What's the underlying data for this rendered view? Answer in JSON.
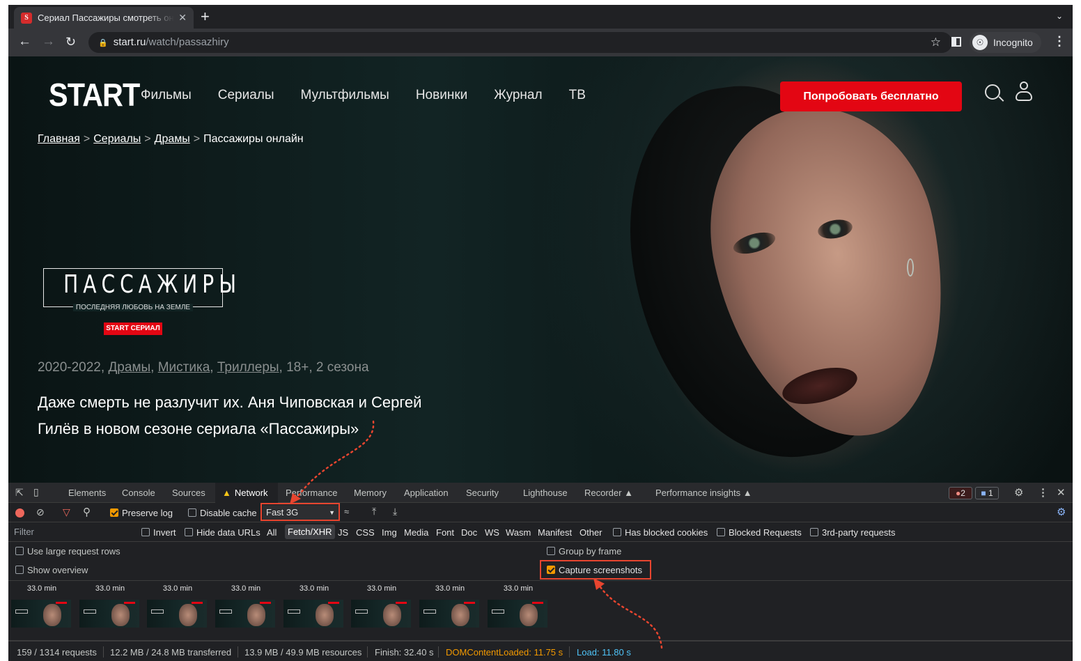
{
  "browser": {
    "tab_title": "Сериал Пассажиры смотреть онлайн",
    "tab_close": "✕",
    "new_tab": "+",
    "tab_menu": "⌄",
    "url_host": "start.ru",
    "url_path": "/watch/passazhiry",
    "incognito_label": "Incognito"
  },
  "site": {
    "logo": "START",
    "nav": [
      "Фильмы",
      "Сериалы",
      "Мультфильмы",
      "Новинки",
      "Журнал",
      "ТВ"
    ],
    "cta": "Попробовать бесплатно",
    "breadcrumb": [
      "Главная",
      "Сериалы",
      "Драмы",
      "Пассажиры онлайн"
    ],
    "breadcrumb_sep": ">",
    "title_logo": "ПАССАЖИРЫ",
    "title_logo_sub": "ПОСЛЕДНЯЯ ЛЮБОВЬ НА ЗЕМЛЕ",
    "badge": "START СЕРИАЛ",
    "meta": {
      "years": "2020-2022",
      "genres": [
        "Драмы",
        "Мистика",
        "Триллеры"
      ],
      "age": "18+",
      "seasons": "2 сезона"
    },
    "description": "Даже смерть не разлучит их. Аня Чиповская и Сергей Гилёв в новом сезоне сериала «Пассажиры»"
  },
  "devtools": {
    "tabs": [
      "Elements",
      "Console",
      "Sources",
      "Network",
      "Performance",
      "Memory",
      "Application",
      "Security",
      "Lighthouse",
      "Recorder",
      "Performance insights"
    ],
    "active_tab": "Network",
    "errors": "2",
    "messages": "1",
    "preserve_log": "Preserve log",
    "disable_cache": "Disable cache",
    "throttling": "Fast 3G",
    "filter_placeholder": "Filter",
    "invert": "Invert",
    "hide_data_urls": "Hide data URLs",
    "filter_types": [
      "All",
      "Fetch/XHR",
      "JS",
      "CSS",
      "Img",
      "Media",
      "Font",
      "Doc",
      "WS",
      "Wasm",
      "Manifest",
      "Other"
    ],
    "active_filter": "Fetch/XHR",
    "has_blocked_cookies": "Has blocked cookies",
    "blocked_requests": "Blocked Requests",
    "third_party": "3rd-party requests",
    "use_large_rows": "Use large request rows",
    "show_overview": "Show overview",
    "group_by_frame": "Group by frame",
    "capture_screenshots": "Capture screenshots",
    "screenshot_times": [
      "33.0 min",
      "33.0 min",
      "33.0 min",
      "33.0 min",
      "33.0 min",
      "33.0 min",
      "33.0 min",
      "33.0 min"
    ],
    "status": {
      "requests": "159 / 1314 requests",
      "transferred": "12.2 MB / 24.8 MB transferred",
      "resources": "13.9 MB / 49.9 MB resources",
      "finish": "Finish: 32.40 s",
      "dom_content_loaded": "DOMContentLoaded: 11.75 s",
      "load": "Load: 11.80 s"
    }
  },
  "colors": {
    "brand_red": "#e30613",
    "annotation": "#e8452f",
    "checkbox_on": "#f29900"
  }
}
